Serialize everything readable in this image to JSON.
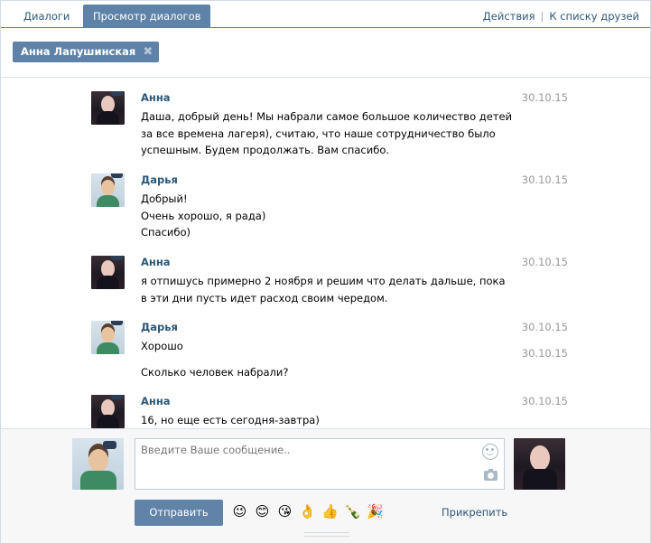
{
  "tabs": [
    {
      "label": "Диалоги",
      "active": false
    },
    {
      "label": "Просмотр диалогов",
      "active": true
    }
  ],
  "top_links": {
    "actions": "Действия",
    "friends": "К списку друзей",
    "separator": "|"
  },
  "chip": {
    "name": "Анна Лапушинская",
    "close_icon": "✖"
  },
  "messages": [
    {
      "author": "Анна",
      "avatar": "anna",
      "date": "30.10.15",
      "lines": [
        "Даша, добрый день! Мы набрали самое большое количество детей",
        "за все времена лагеря), считаю, что наше сотрудничество было",
        "успешным. Будем продолжать. Вам спасибо."
      ]
    },
    {
      "author": "Дарья",
      "avatar": "darya",
      "date": "30.10.15",
      "lines": [
        "Добрый!",
        "Очень хорошо, я рада)",
        "Спасибо)"
      ]
    },
    {
      "author": "Анна",
      "avatar": "anna",
      "date": "30.10.15",
      "lines": [
        "я отпишусь примерно 2 ноября и решим что делать дальше, пока",
        "в эти дни пусть идет расход своим чередом."
      ]
    },
    {
      "author": "Дарья",
      "avatar": "darya",
      "date": "30.10.15",
      "lines": [
        "Хорошо"
      ]
    },
    {
      "author": "",
      "avatar": "",
      "date": "30.10.15",
      "lines": [
        "Сколько человек набрали?"
      ]
    },
    {
      "author": "Анна",
      "avatar": "anna",
      "date": "30.10.15",
      "lines": [
        "16, но еще есть сегодня-завтра)"
      ]
    }
  ],
  "compose": {
    "placeholder": "Введите Ваше сообщение..",
    "send_label": "Отправить",
    "attach_label": "Прикрепить",
    "emojis": [
      "😉",
      "😊",
      "😘",
      "👌",
      "👍",
      "🍾",
      "🎉"
    ]
  },
  "colors": {
    "accent": "#5e82a8",
    "link": "#2b587a",
    "date": "#999999"
  }
}
